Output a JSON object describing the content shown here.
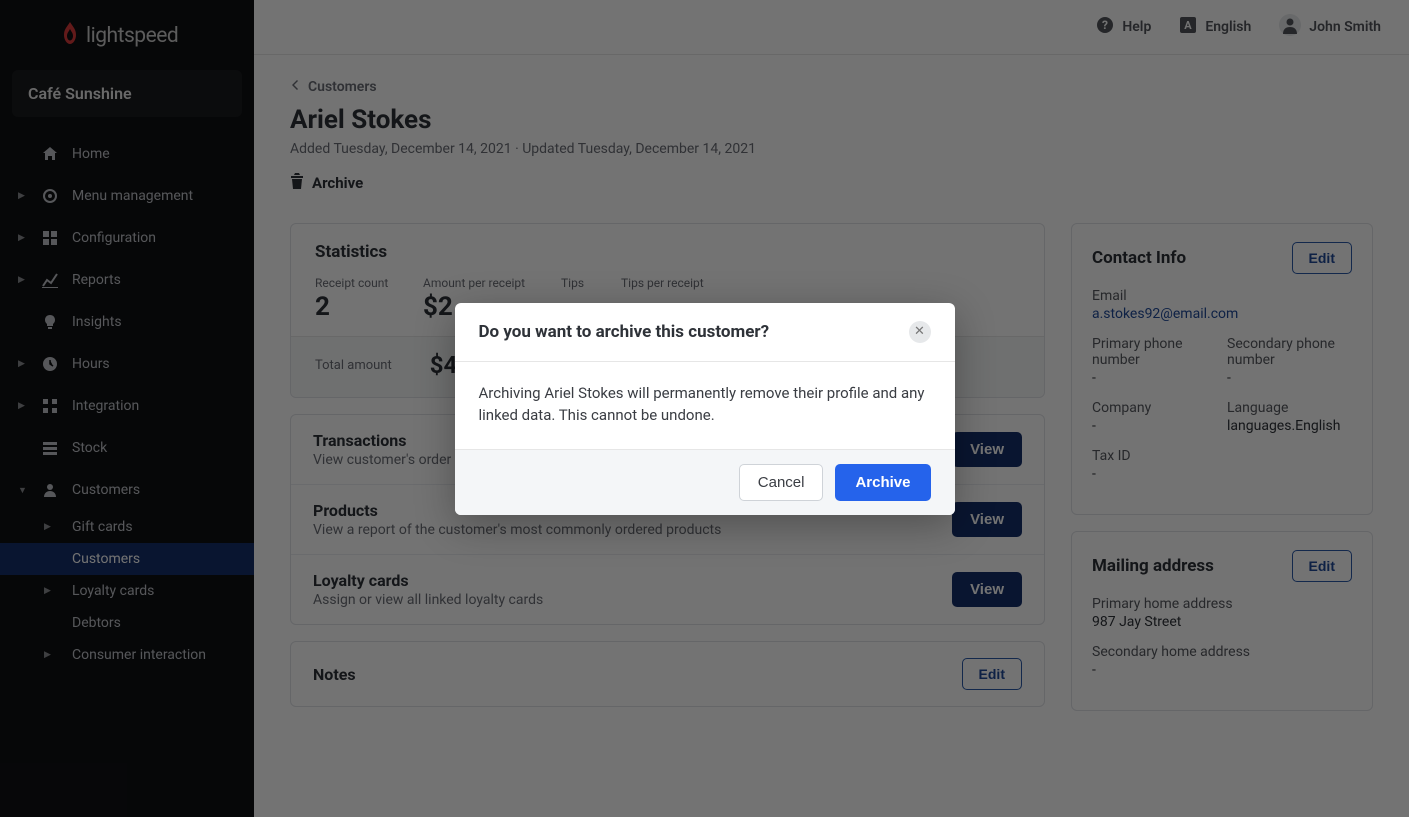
{
  "brand": "lightspeed",
  "company": "Café Sunshine",
  "nav": {
    "home": "Home",
    "menu_management": "Menu management",
    "configuration": "Configuration",
    "reports": "Reports",
    "insights": "Insights",
    "hours": "Hours",
    "integration": "Integration",
    "stock": "Stock",
    "customers": "Customers",
    "sub": {
      "gift_cards": "Gift cards",
      "customers": "Customers",
      "loyalty_cards": "Loyalty cards",
      "debtors": "Debtors",
      "consumer_interaction": "Consumer interaction"
    }
  },
  "topbar": {
    "help": "Help",
    "language": "English",
    "user_name": "John Smith"
  },
  "breadcrumb": "Customers",
  "customer_name": "Ariel Stokes",
  "subtitle": "Added Tuesday, December 14, 2021 · Updated Tuesday, December 14, 2021",
  "archive_label": "Archive",
  "statistics": {
    "title": "Statistics",
    "receipt_count_label": "Receipt count",
    "receipt_count_value": "2",
    "amount_per_receipt_label": "Amount per receipt",
    "amount_per_receipt_value": "$2",
    "tips_label": "Tips",
    "tips_per_receipt_label": "Tips per receipt",
    "total_amount_label": "Total amount",
    "total_amount_value": "$4"
  },
  "sections": {
    "transactions": {
      "title": "Transactions",
      "sub": "View customer's order",
      "view": "View"
    },
    "products": {
      "title": "Products",
      "sub": "View a report of the customer's most commonly ordered products",
      "view": "View"
    },
    "loyalty_cards": {
      "title": "Loyalty cards",
      "sub": "Assign or view all linked loyalty cards",
      "view": "View"
    },
    "notes": {
      "title": "Notes",
      "edit": "Edit"
    }
  },
  "contact_info": {
    "title": "Contact Info",
    "edit": "Edit",
    "email_label": "Email",
    "email_value": "a.stokes92@email.com",
    "primary_phone_label": "Primary phone number",
    "primary_phone_value": "-",
    "secondary_phone_label": "Secondary phone number",
    "secondary_phone_value": "-",
    "company_label": "Company",
    "company_value": "-",
    "language_label": "Language",
    "language_value": "languages.English",
    "tax_id_label": "Tax ID",
    "tax_id_value": "-"
  },
  "mailing_address": {
    "title": "Mailing address",
    "edit": "Edit",
    "primary_label": "Primary home address",
    "primary_value": "987 Jay Street",
    "secondary_label": "Secondary home address",
    "secondary_value": "-"
  },
  "modal": {
    "title": "Do you want to archive this customer?",
    "body": "Archiving Ariel Stokes will permanently remove their profile and any linked data. This cannot be undone.",
    "cancel": "Cancel",
    "archive": "Archive"
  }
}
